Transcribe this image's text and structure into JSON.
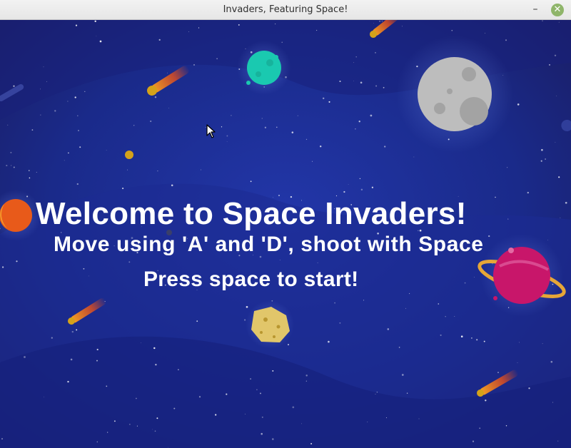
{
  "window": {
    "title": "Invaders, Featuring Space!",
    "minimize_glyph": "–",
    "close_glyph": "✕"
  },
  "screen": {
    "headline": "Welcome to Space Invaders!",
    "instructions": "Move using 'A' and 'D', shoot with Space",
    "prompt": "Press space to start!"
  },
  "colors": {
    "space_bg": "#1d2a8a",
    "planet_teal": "#1ac9b0",
    "moon_gray": "#bdbdbd",
    "planet_magenta": "#c8166a",
    "ring_gold": "#e6a637",
    "planet_orange": "#e85a1a",
    "comet_orange": "#f06a18"
  },
  "icons": [
    "mouse-cursor-icon",
    "close-icon",
    "minimize-icon"
  ]
}
